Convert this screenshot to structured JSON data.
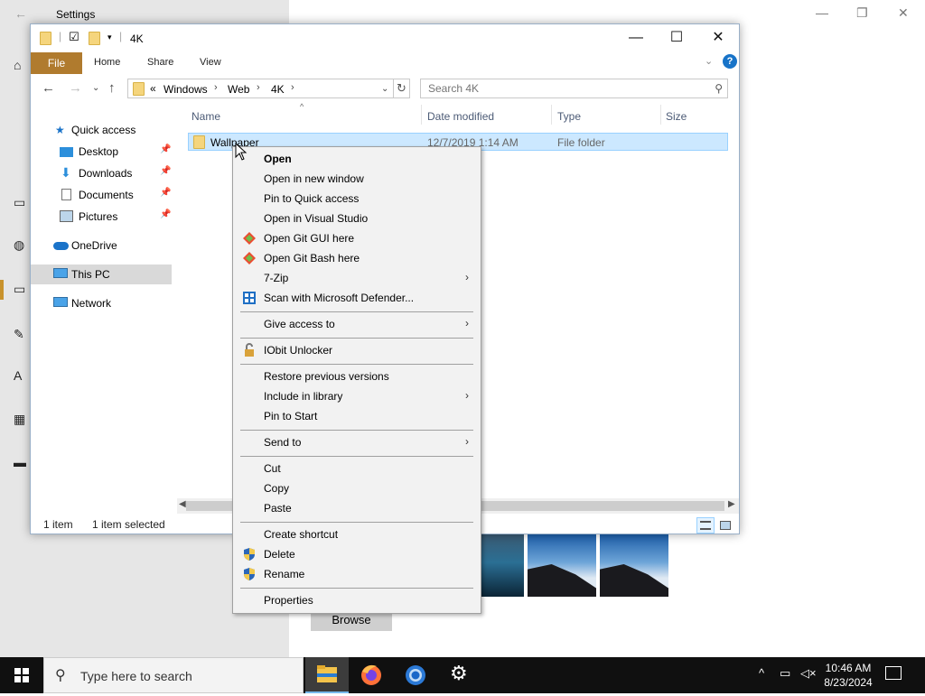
{
  "settings": {
    "title": "Settings",
    "browse_label": "Browse"
  },
  "explorer": {
    "title": "4K",
    "ribbon_tabs": [
      "File",
      "Home",
      "Share",
      "View"
    ],
    "address": {
      "overflow": "«",
      "crumbs": [
        "Windows",
        "Web",
        "4K"
      ]
    },
    "search": {
      "placeholder": "Search 4K"
    },
    "nav_items": [
      {
        "label": "Quick access",
        "icon": "star-icon"
      },
      {
        "label": "Desktop",
        "icon": "desktop-icon",
        "pinned": true
      },
      {
        "label": "Downloads",
        "icon": "download-icon",
        "pinned": true
      },
      {
        "label": "Documents",
        "icon": "documents-icon",
        "pinned": true
      },
      {
        "label": "Pictures",
        "icon": "pictures-icon",
        "pinned": true
      },
      {
        "label": "OneDrive",
        "icon": "cloud-icon"
      },
      {
        "label": "This PC",
        "icon": "computer-icon",
        "selected": true
      },
      {
        "label": "Network",
        "icon": "network-icon"
      }
    ],
    "columns": [
      "Name",
      "Date modified",
      "Type",
      "Size"
    ],
    "files": [
      {
        "name": "Wallpaper",
        "date": "12/7/2019 1:14 AM",
        "type": "File folder",
        "size": ""
      }
    ],
    "status": {
      "count": "1 item",
      "selected": "1 item selected"
    }
  },
  "context_menu": {
    "items": [
      {
        "label": "Open",
        "bold": true
      },
      {
        "label": "Open in new window"
      },
      {
        "label": "Pin to Quick access"
      },
      {
        "label": "Open in Visual Studio"
      },
      {
        "label": "Open Git GUI here",
        "icon": "git-icon"
      },
      {
        "label": "Open Git Bash here",
        "icon": "git-icon"
      },
      {
        "label": "7-Zip",
        "submenu": true
      },
      {
        "label": "Scan with Microsoft Defender...",
        "icon": "defender-icon"
      },
      {
        "label": "Give access to",
        "submenu": true
      },
      {
        "label": "IObit Unlocker",
        "icon": "unlocker-icon"
      },
      {
        "label": "Restore previous versions"
      },
      {
        "label": "Include in library",
        "submenu": true
      },
      {
        "label": "Pin to Start"
      },
      {
        "label": "Send to",
        "submenu": true
      },
      {
        "label": "Cut"
      },
      {
        "label": "Copy"
      },
      {
        "label": "Paste"
      },
      {
        "label": "Create shortcut"
      },
      {
        "label": "Delete",
        "icon": "shield-icon"
      },
      {
        "label": "Rename",
        "icon": "shield-icon"
      },
      {
        "label": "Properties"
      }
    ]
  },
  "taskbar": {
    "search_placeholder": "Type here to search",
    "apps": [
      "file-explorer-icon",
      "firefox-icon",
      "chrome-icon",
      "settings-gear-icon"
    ],
    "time": "10:46 AM",
    "date": "8/23/2024"
  },
  "colors": {
    "file_tab": "#b07b2e",
    "selection": "#cce8ff",
    "accent": "#1773c8"
  }
}
